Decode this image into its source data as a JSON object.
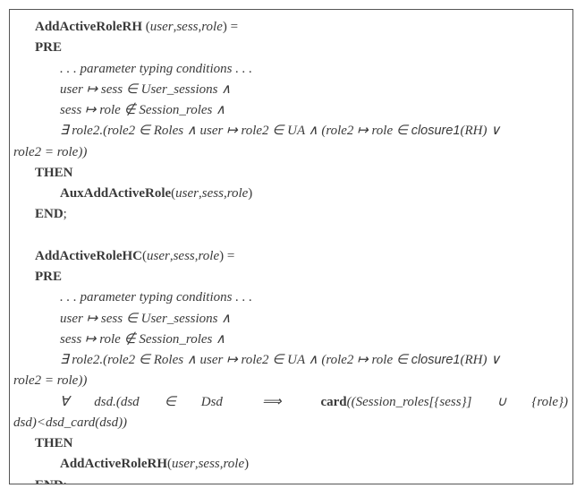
{
  "op1": {
    "sig_a": "AddActiveRoleRH",
    "sig_b": " (",
    "sig_c": "user",
    "sig_d": ",",
    "sig_e": "sess",
    "sig_f": ",",
    "sig_g": "role",
    "sig_h": ") =",
    "pre_kw": "PRE",
    "p_typing": ". . . parameter typing conditions . . .",
    "c1": "user ↦ sess ∈ User_sessions ∧",
    "c2": "sess ↦ role ∉ Session_roles ∧",
    "c3a": "∃ role2.(role2 ∈ Roles ∧ user ↦ role2 ∈ UA ∧ (role2 ↦ role ∈ ",
    "c3b": "closure1",
    "c3c": "(RH) ∨",
    "c3w": "role2 = role))",
    "then_kw": "THEN",
    "body_a": "AuxAddActiveRole",
    "body_b": "(",
    "body_c": "user",
    "body_d": ",",
    "body_e": "sess",
    "body_f": ",",
    "body_g": "role",
    "body_h": ")",
    "end_kw": "END",
    "end_semi": ";"
  },
  "op2": {
    "sig_a": "AddActiveRoleHC",
    "sig_b": "(",
    "sig_c": "user",
    "sig_d": ",",
    "sig_e": "sess",
    "sig_f": ",",
    "sig_g": "role",
    "sig_h": ") =",
    "pre_kw": "PRE",
    "p_typing": ". . . parameter typing conditions . . .",
    "c1": "user ↦ sess ∈ User_sessions ∧",
    "c2": "sess ↦ role ∉ Session_roles ∧",
    "c3a": "∃ role2.(role2 ∈ Roles ∧ user ↦ role2 ∈ UA ∧ (role2 ↦ role ∈ ",
    "c3b": "closure1",
    "c3c": "(RH) ∨",
    "c3w": "role2 = role))",
    "c4a": "∀",
    "c4b": "dsd.(dsd",
    "c4c": "∈",
    "c4d": "Dsd",
    "c4e": "⟹",
    "c4f": "card",
    "c4g": "((Session_roles[{sess}]",
    "c4h": "∪",
    "c4i": "{role})",
    "c4j": "∩",
    "c4w": "dsd)<dsd_card(dsd))",
    "then_kw": "THEN",
    "body_a": "AddActiveRoleRH",
    "body_b": "(",
    "body_c": "user",
    "body_d": ",",
    "body_e": "sess",
    "body_f": ",",
    "body_g": "role",
    "body_h": ")",
    "end_kw": "END",
    "end_semi": ";"
  }
}
